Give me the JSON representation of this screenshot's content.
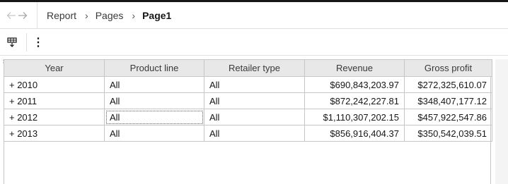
{
  "breadcrumb": {
    "back_icon": "arrow-left-icon",
    "forward_icon": "arrow-right-icon",
    "items": [
      "Report",
      "Pages",
      "Page1"
    ],
    "separator": "›"
  },
  "toolbar": {
    "filter_icon": "table-filter-icon",
    "more_label": "⋮"
  },
  "table": {
    "columns": [
      "Year",
      "Product line",
      "Retailer type",
      "Revenue",
      "Gross profit"
    ],
    "rows": [
      {
        "year": "+ 2010",
        "product_line": "All",
        "retailer_type": "All",
        "revenue": "$690,843,203.97",
        "gross_profit": "$272,325,610.07"
      },
      {
        "year": "+ 2011",
        "product_line": "All",
        "retailer_type": "All",
        "revenue": "$872,242,227.81",
        "gross_profit": "$348,407,177.12"
      },
      {
        "year": "+ 2012",
        "product_line": "All",
        "retailer_type": "All",
        "revenue": "$1,110,307,202.15",
        "gross_profit": "$457,922,547.86"
      },
      {
        "year": "+ 2013",
        "product_line": "All",
        "retailer_type": "All",
        "revenue": "$856,916,404.37",
        "gross_profit": "$350,542,039.51"
      }
    ],
    "selected_cell": "row 3, Product line"
  }
}
